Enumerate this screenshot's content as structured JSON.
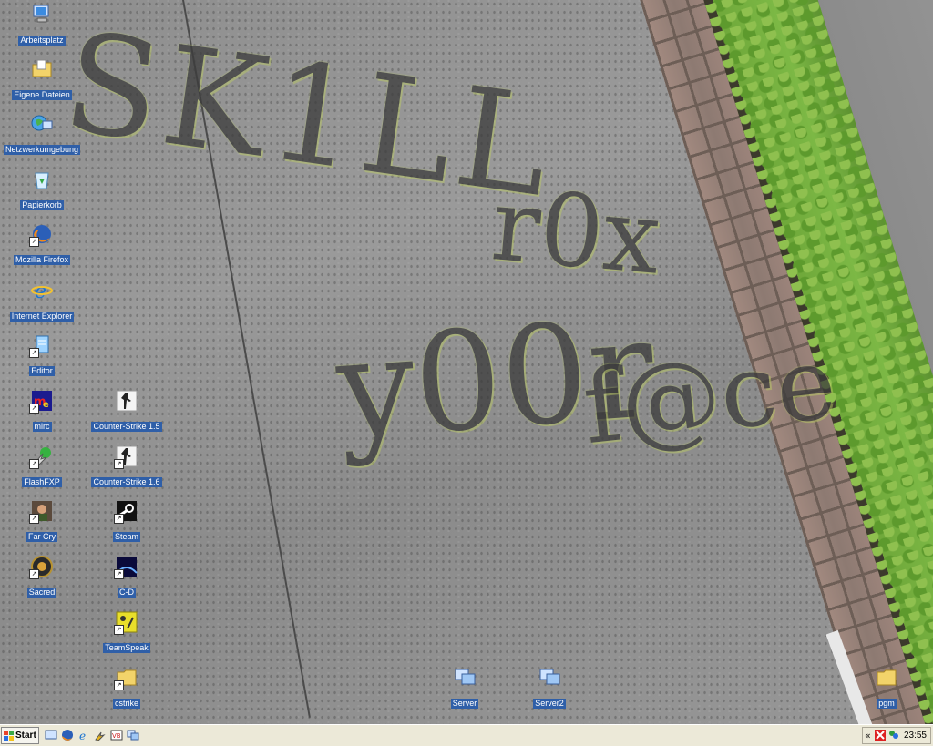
{
  "wallpaper": {
    "graffiti_line1": "SK1LL",
    "graffiti_line2": "r0x",
    "graffiti_line3": "y00r",
    "graffiti_line4": "f@ce"
  },
  "desktop_icons": [
    {
      "label": "Arbeitsplatz",
      "icon": "my-computer-icon"
    },
    {
      "label": "Eigene Dateien",
      "icon": "my-documents-icon"
    },
    {
      "label": "Netzwerkumgebung",
      "icon": "network-places-icon"
    },
    {
      "label": "Papierkorb",
      "icon": "recycle-bin-icon"
    },
    {
      "label": "Mozilla Firefox",
      "icon": "firefox-icon"
    },
    {
      "label": "Internet Explorer",
      "icon": "internet-explorer-icon"
    },
    {
      "label": "Editor",
      "icon": "notepad-icon"
    },
    {
      "label": "mirc",
      "icon": "mirc-icon"
    },
    {
      "label": "FlashFXP",
      "icon": "flashfxp-icon"
    },
    {
      "label": "Far Cry",
      "icon": "far-cry-icon"
    },
    {
      "label": "Sacred",
      "icon": "sacred-icon"
    },
    {
      "label": "Counter-Strike 1.5",
      "icon": "counter-strike-icon"
    },
    {
      "label": "Counter-Strike 1.6",
      "icon": "counter-strike-icon"
    },
    {
      "label": "Steam",
      "icon": "steam-icon"
    },
    {
      "label": "C-D",
      "icon": "cd-icon"
    },
    {
      "label": "TeamSpeak",
      "icon": "teamspeak-icon"
    },
    {
      "label": "cstrike",
      "icon": "folder-icon"
    },
    {
      "label": "Server",
      "icon": "server-icon"
    },
    {
      "label": "Server2",
      "icon": "server-icon"
    },
    {
      "label": "pgm",
      "icon": "folder-icon"
    }
  ],
  "taskbar": {
    "start_label": "Start",
    "quick_launch": [
      "desktop-icon",
      "firefox-icon",
      "internet-explorer-icon",
      "flashfxp-icon",
      "vb-icon",
      "network-icon"
    ],
    "tray_expand": "«",
    "clock": "23:55"
  }
}
